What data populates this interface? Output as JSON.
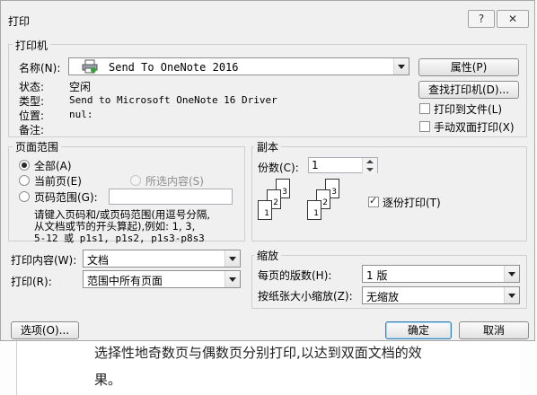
{
  "window": {
    "title": "打印",
    "help_label": "?",
    "close_label": "✕"
  },
  "printer": {
    "group_title": "打印机",
    "name_label": "名称(N):",
    "name_value": "Send To OneNote 2016",
    "status_label": "状态:",
    "status_value": "空闲",
    "type_label": "类型:",
    "type_value": "Send to Microsoft OneNote 16 Driver",
    "where_label": "位置:",
    "where_value": "nul:",
    "comment_label": "备注:",
    "comment_value": "",
    "properties_button": "属性(P)",
    "find_button": "查找打印机(D)...",
    "print_to_file_label": "打印到文件(L)",
    "print_to_file_checked": false,
    "manual_duplex_label": "手动双面打印(X)",
    "manual_duplex_checked": false
  },
  "page_range": {
    "group_title": "页面范围",
    "all_label": "全部(A)",
    "current_label": "当前页(E)",
    "selection_label": "所选内容(S)",
    "pages_label": "页码范围(G):",
    "pages_value": "",
    "selected": "all",
    "hint_line1": "请键入页码和/或页码范围(用逗号分隔,",
    "hint_line2": "从文档或节的开头算起),例如: 1, 3,",
    "hint_line3": "5-12 或 p1s1, p1s2, p1s3-p8s3"
  },
  "copies": {
    "group_title": "副本",
    "copies_label": "份数(C):",
    "copies_value": "1",
    "collate_label": "逐份打印(T)",
    "collate_checked": true,
    "page_numbers": [
      "1",
      "2",
      "3"
    ]
  },
  "print_what": {
    "label": "打印内容(W):",
    "value": "文档"
  },
  "print_range": {
    "label": "打印(R):",
    "value": "范围中所有页面"
  },
  "zoom": {
    "group_title": "缩放",
    "pages_per_sheet_label": "每页的版数(H):",
    "pages_per_sheet_value": "1 版",
    "scale_label": "按纸张大小缩放(Z):",
    "scale_value": "无缩放"
  },
  "footer": {
    "options_button": "选项(O)...",
    "ok_button": "确定",
    "cancel_button": "取消"
  },
  "background_document": {
    "line1": "选择性地奇数页与偶数页分别打印,以达到双面文档的效",
    "line2": "果。"
  }
}
